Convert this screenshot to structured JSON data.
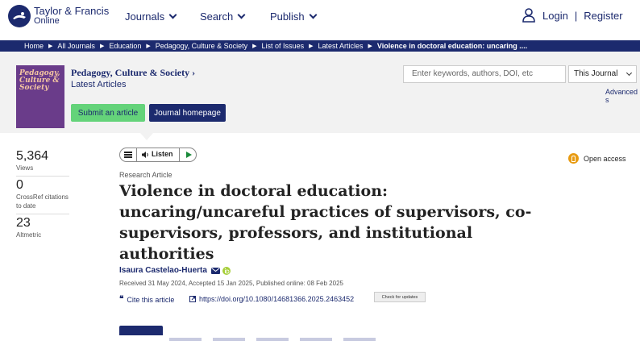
{
  "brand": {
    "line1": "Taylor & Francis",
    "line2": "Online"
  },
  "nav": [
    {
      "label": "Journals"
    },
    {
      "label": "Search"
    },
    {
      "label": "Publish"
    }
  ],
  "account": {
    "login": "Login",
    "sep": "|",
    "register": "Register"
  },
  "breadcrumbs": [
    "Home",
    "All Journals",
    "Education",
    "Pedagogy, Culture & Society",
    "List of Issues",
    "Latest Articles",
    "Violence in doctoral education: uncaring ...."
  ],
  "journal": {
    "title": "Pedagogy, Culture & Society",
    "subtitle": "Latest Articles",
    "cover_title": "Pedagogy, Culture & Society",
    "submit_label": "Submit an article",
    "homepage_label": "Journal homepage"
  },
  "search": {
    "placeholder": "Enter keywords, authors, DOI, etc",
    "scope": "This Journal",
    "advanced": "Advanced s"
  },
  "metrics": [
    {
      "value": "5,364",
      "label": "Views"
    },
    {
      "value": "0",
      "label": "CrossRef citations to date"
    },
    {
      "value": "23",
      "label": "Altmetric"
    }
  ],
  "toolbar": {
    "listen_label": "Listen"
  },
  "article": {
    "type": "Research Article",
    "title": "Violence in doctoral education: uncaring/uncareful practices of supervisors, co-supervisors, professors, and institutional authorities",
    "author": "Isaura Castelao-Huerta",
    "dates": "Received 31 May 2024, Accepted 15 Jan 2025, Published online: 08 Feb 2025",
    "cite_label": "Cite this article",
    "doi": "https://doi.org/10.1080/14681366.2025.2463452",
    "updates_label": "Check for updates",
    "access": "Open access"
  },
  "colors": {
    "navy": "#1c2a6e",
    "green": "#64d37a",
    "oa": "#e89b12"
  }
}
